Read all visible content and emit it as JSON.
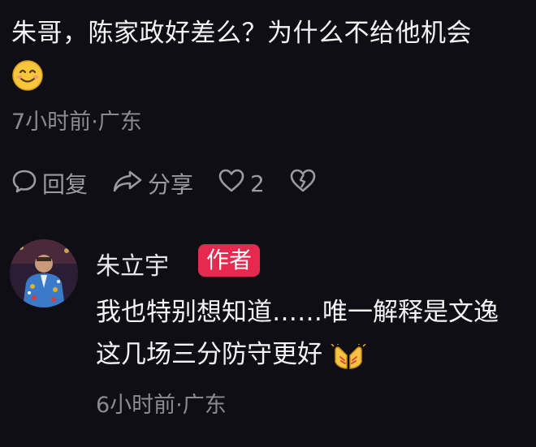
{
  "comment": {
    "text": "朱哥，陈家政好差么？为什么不给他机会",
    "emoji": "smiling-face-icon",
    "time": "7小时前",
    "location": "广东"
  },
  "actions": {
    "reply_label": "回复",
    "share_label": "分享",
    "like_count": "2"
  },
  "reply": {
    "author": "朱立宇",
    "badge": "作者",
    "text_line1": "我也特别想知道……唯一解释是文逸",
    "text_line2": "这几场三分防守更好",
    "emoji": "clapping-hands-icon",
    "time": "6小时前",
    "location": "广东"
  },
  "colors": {
    "background": "#0e0e14",
    "badge": "#e5294f",
    "meta": "#8a8a90"
  }
}
